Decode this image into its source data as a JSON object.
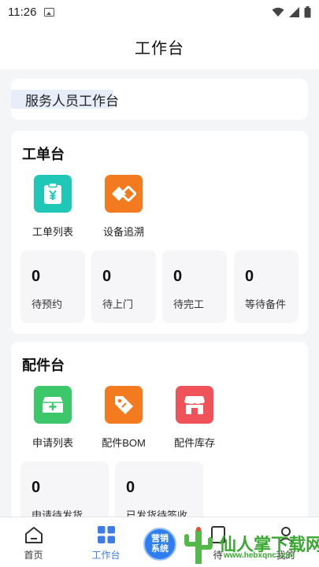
{
  "status": {
    "time": "11:26"
  },
  "header": {
    "title": "工作台"
  },
  "role": {
    "label": "服务人员工作台"
  },
  "work": {
    "title": "工单台",
    "shortcuts": [
      {
        "label": "工单列表",
        "icon": "clipboard-yen-icon",
        "color": "#1ec7b6"
      },
      {
        "label": "设备追溯",
        "icon": "link-diamond-icon",
        "color": "#f47a1f"
      }
    ],
    "stats": [
      {
        "value": "0",
        "label": "待预约"
      },
      {
        "value": "0",
        "label": "待上门"
      },
      {
        "value": "0",
        "label": "待完工"
      },
      {
        "value": "0",
        "label": "等待备件"
      }
    ]
  },
  "parts": {
    "title": "配件台",
    "shortcuts": [
      {
        "label": "申请列表",
        "icon": "medical-box-icon",
        "color": "#3cc76a"
      },
      {
        "label": "配件BOM",
        "icon": "price-tag-icon",
        "color": "#f47a1f"
      },
      {
        "label": "配件库存",
        "icon": "store-icon",
        "color": "#f0525a"
      }
    ],
    "stats": [
      {
        "value": "0",
        "label": "申请待发货"
      },
      {
        "value": "0",
        "label": "已发货待签收"
      }
    ]
  },
  "nav": {
    "items": [
      {
        "label": "首页"
      },
      {
        "label": "工作台"
      },
      {
        "label": "待"
      },
      {
        "label": "我的"
      }
    ],
    "promo": "营销\n系统"
  },
  "watermark": {
    "text": "仙人掌下载网",
    "url": "www.hebxqnc.com"
  },
  "colors": {
    "accent": "#3d7be8",
    "bg": "#f4f5f7"
  }
}
